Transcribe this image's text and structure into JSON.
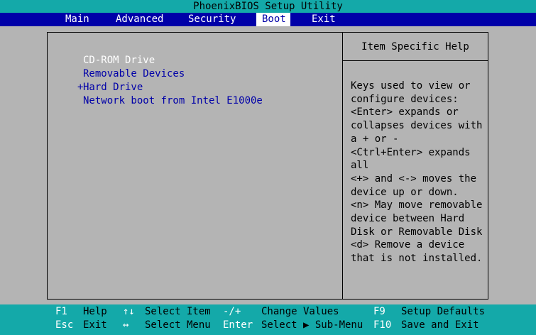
{
  "title": "PhoenixBIOS Setup Utility",
  "menu": {
    "items": [
      {
        "label": "Main"
      },
      {
        "label": "Advanced"
      },
      {
        "label": "Security"
      },
      {
        "label": "Boot",
        "active": true
      },
      {
        "label": "Exit"
      }
    ]
  },
  "boot_order": {
    "items": [
      {
        "prefix": "",
        "label": "CD-ROM Drive",
        "selected": true
      },
      {
        "prefix": "",
        "label": "Removable Devices"
      },
      {
        "prefix": "+",
        "label": "Hard Drive"
      },
      {
        "prefix": "",
        "label": "Network boot from Intel E1000e"
      }
    ]
  },
  "help": {
    "title": "Item Specific Help",
    "text": "Keys used to view or\nconfigure devices:\n<Enter> expands or\ncollapses devices with\na + or -\n<Ctrl+Enter> expands\nall\n<+> and <-> moves the\ndevice up or down.\n<n> May move removable\ndevice between Hard\nDisk or Removable Disk\n<d> Remove a device\nthat is not installed."
  },
  "footer": {
    "row1": {
      "k1": "F1",
      "d1": "Help",
      "k2": "↑↓",
      "d2": "Select Item",
      "k3": "-/+",
      "d3": "Change Values",
      "k4": "F9",
      "d4": "Setup Defaults"
    },
    "row2": {
      "k1": "Esc",
      "d1": "Exit",
      "k2": "↔",
      "d2": "Select Menu",
      "k3": "Enter",
      "d3": "Select ▶ Sub-Menu",
      "k4": "F10",
      "d4": "Save and Exit"
    }
  },
  "colors": {
    "title_bar": "#14a9a9",
    "menu_bar": "#0000a8",
    "background": "#b4b4b4",
    "item_text": "#0000a8",
    "selected_text": "#ffffff"
  }
}
